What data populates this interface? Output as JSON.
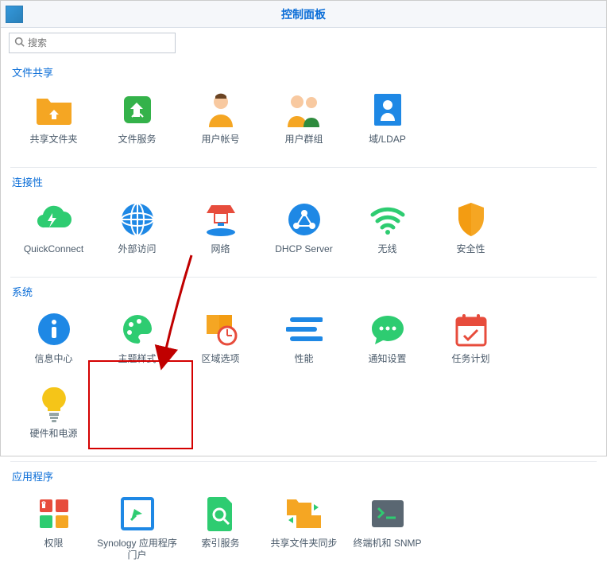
{
  "titlebar": {
    "title": "控制面板"
  },
  "search": {
    "placeholder": "搜索"
  },
  "sections": {
    "fileshare": {
      "title": "文件共享",
      "items": [
        "共享文件夹",
        "文件服务",
        "用户帐号",
        "用户群组",
        "域/LDAP"
      ]
    },
    "connectivity": {
      "title": "连接性",
      "items": [
        "QuickConnect",
        "外部访问",
        "网络",
        "DHCP Server",
        "无线",
        "安全性"
      ]
    },
    "system": {
      "title": "系统",
      "items": [
        "信息中心",
        "主题样式",
        "区域选项",
        "性能",
        "通知设置",
        "任务计划",
        "硬件和电源"
      ]
    },
    "applications": {
      "title": "应用程序",
      "items": [
        "权限",
        "Synology 应用程序门户",
        "索引服务",
        "共享文件夹同步",
        "终端机和 SNMP"
      ]
    }
  }
}
